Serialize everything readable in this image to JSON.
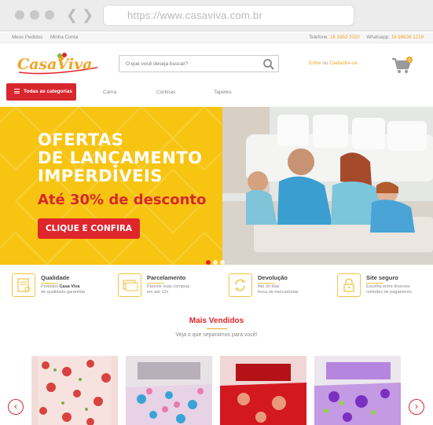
{
  "browser": {
    "url": "https://www.casaviva.com.br"
  },
  "topbar": {
    "links": [
      "Meus Pedidos",
      "Minha Conta"
    ],
    "phone_label": "Telefone:",
    "phone": "16 3352 2020",
    "whatsapp_label": "Whatsapp:",
    "whatsapp": "16 99626 1219"
  },
  "header": {
    "logo_text": "CasaViva",
    "search_placeholder": "O que você deseja buscar?",
    "login": "Entre",
    "login_sep": "ou",
    "register": "Cadastre-se",
    "cart_count": "0"
  },
  "nav": {
    "categories_label": "Todas as categorias",
    "items": [
      "Cama",
      "Cortinas",
      "Tapetes"
    ]
  },
  "hero": {
    "title_lines": [
      "OFERTAS",
      "DE LANÇAMENTO",
      "IMPERDÍVEIS"
    ],
    "subtitle": "Até 30% de desconto",
    "cta": "CLIQUE E CONFIRA",
    "slides": 3,
    "active_slide": 1
  },
  "features": [
    {
      "title": "Qualidade",
      "desc_1": "Produtos ",
      "desc_bold": "Casa Viva",
      "desc_2": "de qualidade garantida",
      "icon": "certificate-icon"
    },
    {
      "title": "Parcelamento",
      "desc_1": "Parcele suas compras",
      "desc_bold": "",
      "desc_2": "em até 12x",
      "icon": "credit-card-icon"
    },
    {
      "title": "Devolução",
      "desc_1": "Até 30 dias",
      "desc_bold": "",
      "desc_2": "troca de mercadorias",
      "icon": "refresh-icon"
    },
    {
      "title": "Site seguro",
      "desc_1": "Escolha entre diversos",
      "desc_bold": "",
      "desc_2": "métodos de pagamento",
      "icon": "lock-icon"
    }
  ],
  "best_sellers": {
    "title": "Mais Vendidos",
    "subtitle": "Veja o que separamos para você!",
    "products": [
      {
        "name": "floral-curtain",
        "color": "#e8a7a4"
      },
      {
        "name": "floral-bedspread-pink",
        "color": "#d7b6d6"
      },
      {
        "name": "red-bedspread",
        "color": "#d3191f"
      },
      {
        "name": "purple-bedspread",
        "color": "#c39ae3"
      }
    ]
  },
  "colors": {
    "accent_red": "#e0262d",
    "accent_yellow": "#f7c411",
    "accent_orange": "#f2a324"
  }
}
